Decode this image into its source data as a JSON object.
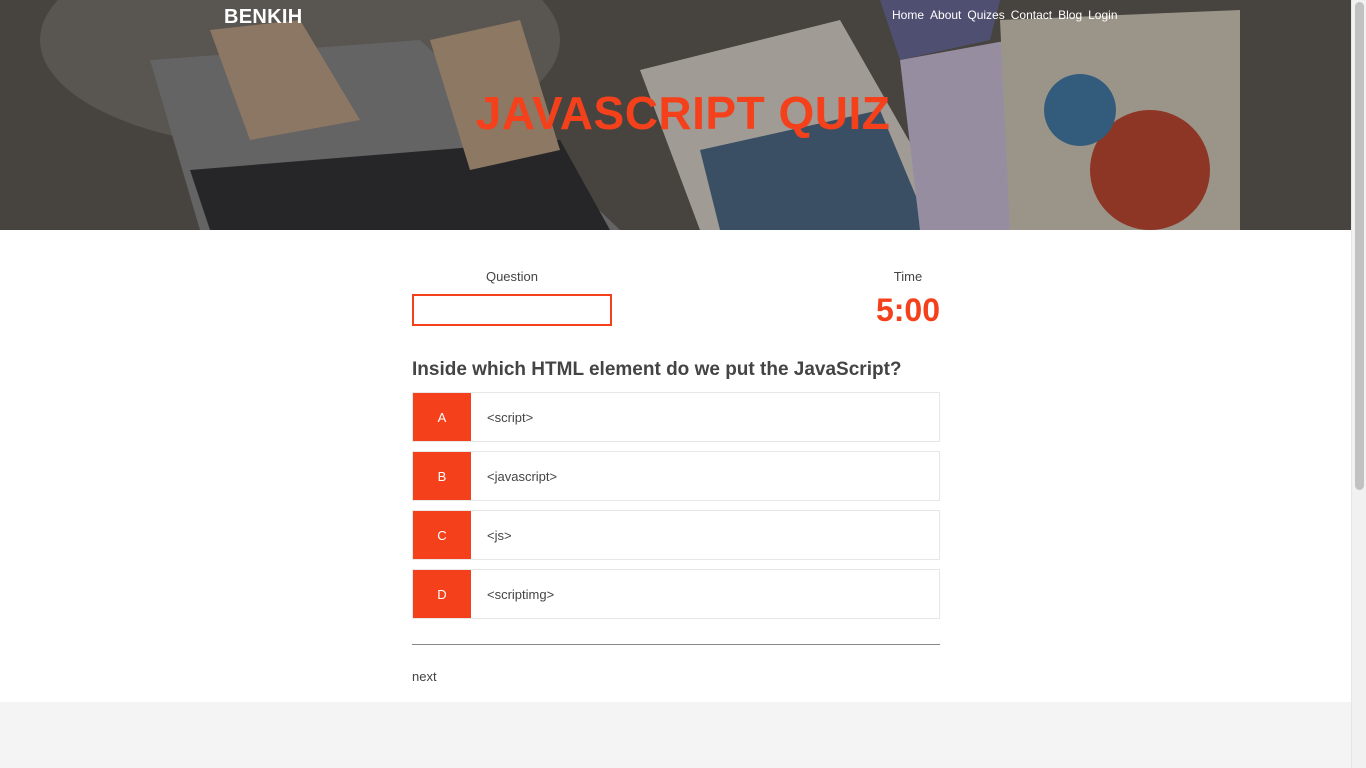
{
  "header": {
    "brand": "BENKIH",
    "nav": [
      "Home",
      "About",
      "Quizes",
      "Contact",
      "Blog",
      "Login"
    ],
    "title": "JAVASCRIPT QUIZ"
  },
  "quiz": {
    "question_label": "Question",
    "time_label": "Time",
    "time_value": "5:00",
    "question": "Inside which HTML element do we put the JavaScript?",
    "answers": [
      {
        "letter": "A",
        "text": "<script>"
      },
      {
        "letter": "B",
        "text": "<javascript>"
      },
      {
        "letter": "C",
        "text": "<js>"
      },
      {
        "letter": "D",
        "text": "<scriptimg>"
      }
    ],
    "next_label": "next"
  },
  "colors": {
    "accent": "#f4411c",
    "text": "#444444",
    "footer_bg": "#f4f4f4"
  }
}
